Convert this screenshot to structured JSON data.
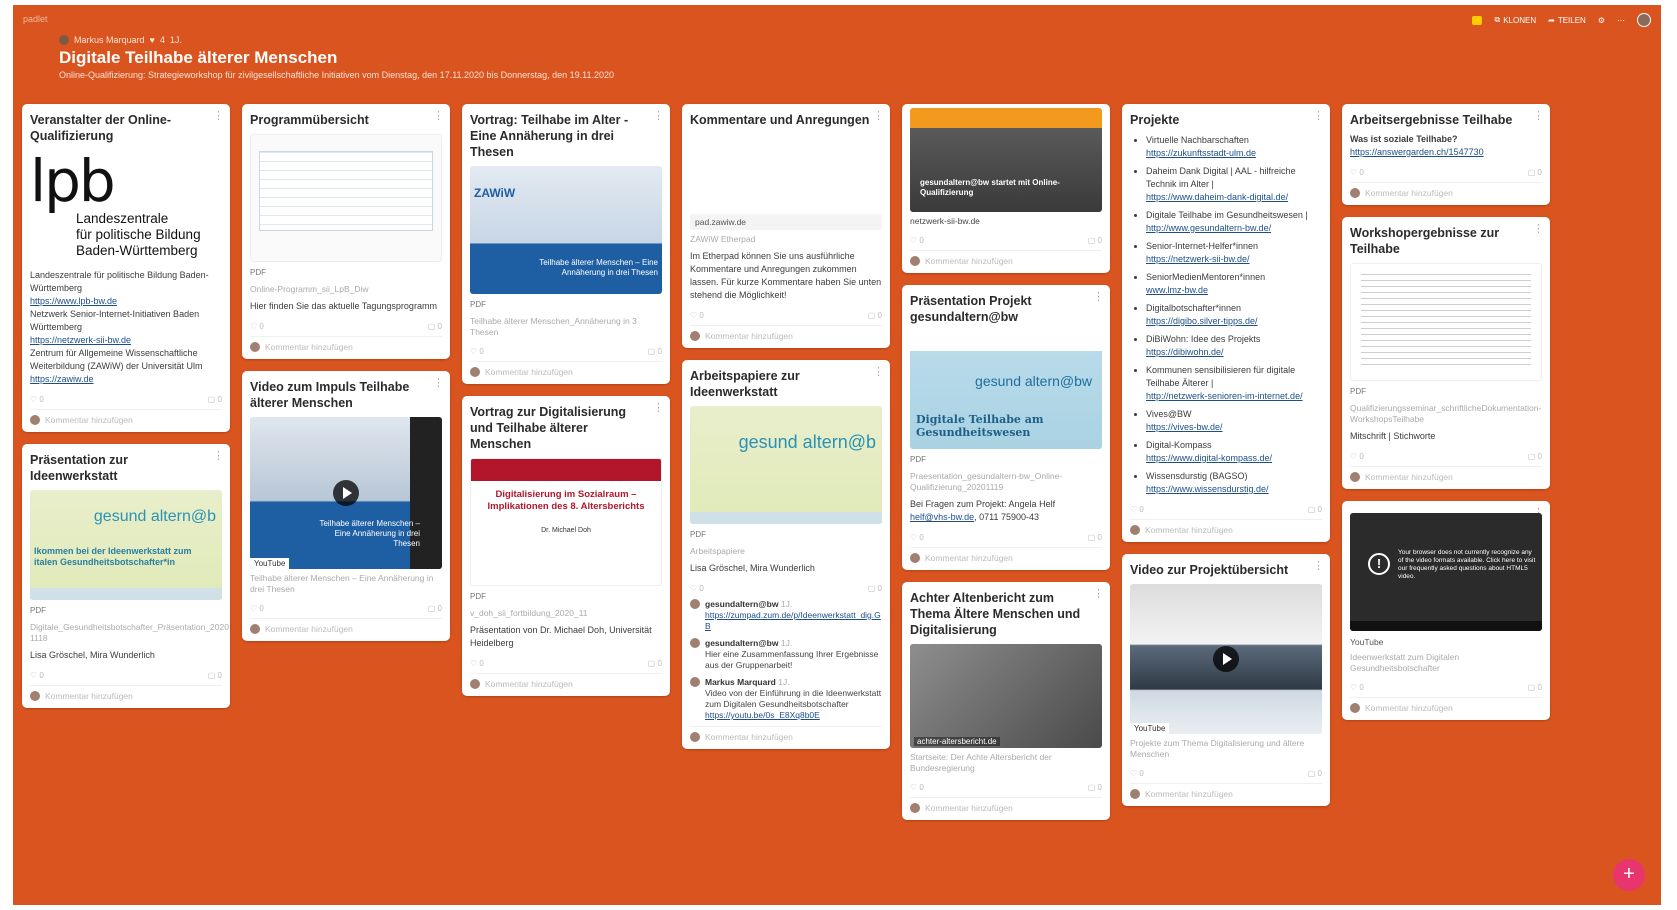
{
  "app": {
    "brand": "padlet"
  },
  "topbar": {
    "clone_label": "KLONEN",
    "share_label": "TEILEN"
  },
  "header": {
    "author": "Markus Marquard",
    "likes": "4",
    "age": "1J.",
    "title": "Digitale Teilhabe älterer Menschen",
    "subtitle": "Online-Qualifizierung: Strategieworkshop für zivilgesellschaftliche Initiativen vom Dienstag, den 17.11.2020 bis Donnerstag, den 19.11.2020"
  },
  "ui": {
    "add_comment": "Kommentar hinzufügen",
    "zero": "0",
    "pdf": "PDF",
    "youtube": "YouTube",
    "add_post_icon": "plus-icon"
  },
  "cards": {
    "veranstalter": {
      "title": "Veranstalter der Online-Qualifizierung",
      "logo_lpb": "lpb",
      "logo_lines": [
        "Landeszentrale",
        "für politische Bildung",
        "Baden-Württemberg"
      ],
      "text1": "Landeszentrale für politische Bildung Baden-Württemberg",
      "link1": "https://www.lpb-bw.de",
      "text2": "Netzwerk Senior-Internet-Initiativen Baden Württemberg",
      "link2": "https://netzwerk-sii-bw.de",
      "text3": "Zentrum für Allgemeine Wissenschaftliche Weiterbildung (ZAWiW) der Universität Ulm",
      "link3": "https://zawiw.de"
    },
    "praesentation_ideen": {
      "title": "Präsentation zur Ideenwerkstatt",
      "thumb_brand": "gesund altern@b",
      "thumb_text": "lkommen bei der Ideenwerkstatt zum italen Gesundheitsbotschafter*in",
      "file": "Digitale_Gesundheitsbotschafter_Präsentation_2020 1118",
      "text": "Lisa Gröschel, Mira Wunderlich"
    },
    "programm": {
      "title": "Programmübersicht",
      "file": "Online-Programm_sii_LpB_Diw",
      "text": "Hier finden Sie das aktuelle Tagungsprogramm"
    },
    "video_impuls": {
      "title": "Video zum Impuls Teilhabe älterer Menschen",
      "thumb_caption": "Teilhabe älterer Menschen – Eine Annäherung in drei Thesen",
      "meta": "Teilhabe älterer Menschen – Eine Annäherung in drei Thesen"
    },
    "vortrag_teilhabe": {
      "title": "Vortrag: Teilhabe im Alter - Eine Annäherung in drei Thesen",
      "thumb_caption": "Teilhabe älterer Menschen – Eine Annäherung in drei Thesen",
      "meta": "Teilhabe älterer Menschen_Annäherung in 3 Thesen"
    },
    "vortrag_digital": {
      "title": "Vortrag zur Digitalisierung und Teilhabe älterer Menschen",
      "thumb_heading": "Digitalisierung im Sozialraum – Implikationen des 8. Altersberichts",
      "thumb_author": "Dr. Michael Doh",
      "file": "v_doh_sii_fortbildung_2020_11",
      "text": "Präsentation von Dr. Michael Doh, Universität Heidelberg"
    },
    "kommentare": {
      "title": "Kommentare und Anregungen",
      "domain": "pad.zawiw.de",
      "meta": "ZAWiW Etherpad",
      "text": "Im Etherpad können Sie uns ausführliche Kommentare und Anregungen zukommen lassen. Für kurze Kommentare haben Sie unten stehend die Möglichkeit!"
    },
    "arbeitspapiere": {
      "title": "Arbeitspapiere zur Ideenwerkstatt",
      "thumb_brand": "gesund altern@b",
      "meta": "Arbeitspapiere",
      "text": "Lisa Gröschel, Mira Wunderlich",
      "comments": [
        {
          "author": "gesundaltern@bw",
          "age": "1J.",
          "text": "https://zumpad.zum.de/p/Ideenwerkstatt_dig.G B"
        },
        {
          "author": "gesundaltern@bw",
          "age": "1J.",
          "text": "Hier eine Zusammenfassung Ihrer Ergebnisse aus der Gruppenarbeit!"
        },
        {
          "author": "Markus Marquard",
          "age": "1J.",
          "text": "Video von der Einführung in die Ideenwerkstatt zum Digitalen Gesundheitsbotschafter",
          "link": "https://youtu.be/0s_E8Xq8b0E"
        }
      ]
    },
    "netzwerk": {
      "thumb_caption": "gesundaltern@bw startet mit Online-Qualifizierung",
      "domain": "netzwerk-sii-bw.de"
    },
    "praesentation_projekt": {
      "title": "Präsentation Projekt gesundaltern@bw",
      "thumb_brand": "gesund altern@bw",
      "thumb_text": "Digitale Teilhabe am Gesundheitswesen",
      "file": "Praesentation_gesundaltern-bw_Online-Qualifizierung_20201119",
      "text": "Bei Fragen zum Projekt: Angela Helf",
      "email": "helf@vhs-bw.de",
      "phone": ", 0711 75900-43"
    },
    "achter": {
      "title": "Achter Altenbericht zum Thema Ältere Menschen und Digitalisierung",
      "domain": "achter-altersbericht.de",
      "meta": "Startseite: Der Achte Altersbericht der Bundesregierung"
    },
    "projekte": {
      "title": "Projekte",
      "items": [
        {
          "text": "Virtuelle Nachbarschaften",
          "link": "https://zukunftsstadt-ulm.de"
        },
        {
          "text": "Daheim Dank Digital | AAL - hilfreiche Technik im Alter |",
          "link": "https://www.daheim-dank-digital.de/"
        },
        {
          "text": "Digitale Teilhabe im Gesundheitswesen |",
          "link": "http://www.gesundaltern-bw.de/"
        },
        {
          "text": "Senior-Internet-Helfer*innen",
          "link": "https://netzwerk-sii-bw.de/"
        },
        {
          "text": "SeniorMedienMentoren*innen",
          "link": "www.lmz-bw.de"
        },
        {
          "text": "Digitalbotschafter*innen",
          "link": "https://digibo.silver-tipps.de/"
        },
        {
          "text": "DiBiWohn: Idee des Projekts",
          "link": "https://dibiwohn.de/"
        },
        {
          "text": "Kommunen sensibilisieren für digitale Teilhabe Älterer |",
          "link": "http://netzwerk-senioren-im-internet.de/"
        },
        {
          "text": "Vives@BW",
          "link": "https://vives-bw.de/"
        },
        {
          "text": "Digital-Kompass",
          "link": "https://www.digital-kompass.de/"
        },
        {
          "text": "Wissensdurstig (BAGSO)",
          "link": "https://www.wissensdurstig.de/"
        }
      ]
    },
    "video_projekt": {
      "title": "Video zur Projektübersicht",
      "meta": "Projekte zum Thema Digitalisierung und ältere Menschen"
    },
    "arbeitsergebnisse": {
      "title": "Arbeitsergebnisse Teilhabe",
      "subtitle": "Was ist soziale Teilhabe?",
      "link": "https://answergarden.ch/1547730"
    },
    "workshopergebnisse": {
      "title": "Workshopergebnisse zur Teilhabe",
      "file": "Qualifizierungsseminar_schriftlicheDokumentation-WorkshopsTeilhabe",
      "text": "Mitschrift | Stichworte"
    },
    "video_ideen": {
      "thumb_text": "Your browser does not currently recognize any of the video formats available. Click here to visit our frequently asked questions about HTML5 video.",
      "meta": "Ideenwerkstatt zum Digitalen Gesundheitsbotschafter"
    }
  },
  "colors": {
    "board": "#d9541f",
    "accent_fab": "#e8356e",
    "link": "#1d4e89"
  }
}
